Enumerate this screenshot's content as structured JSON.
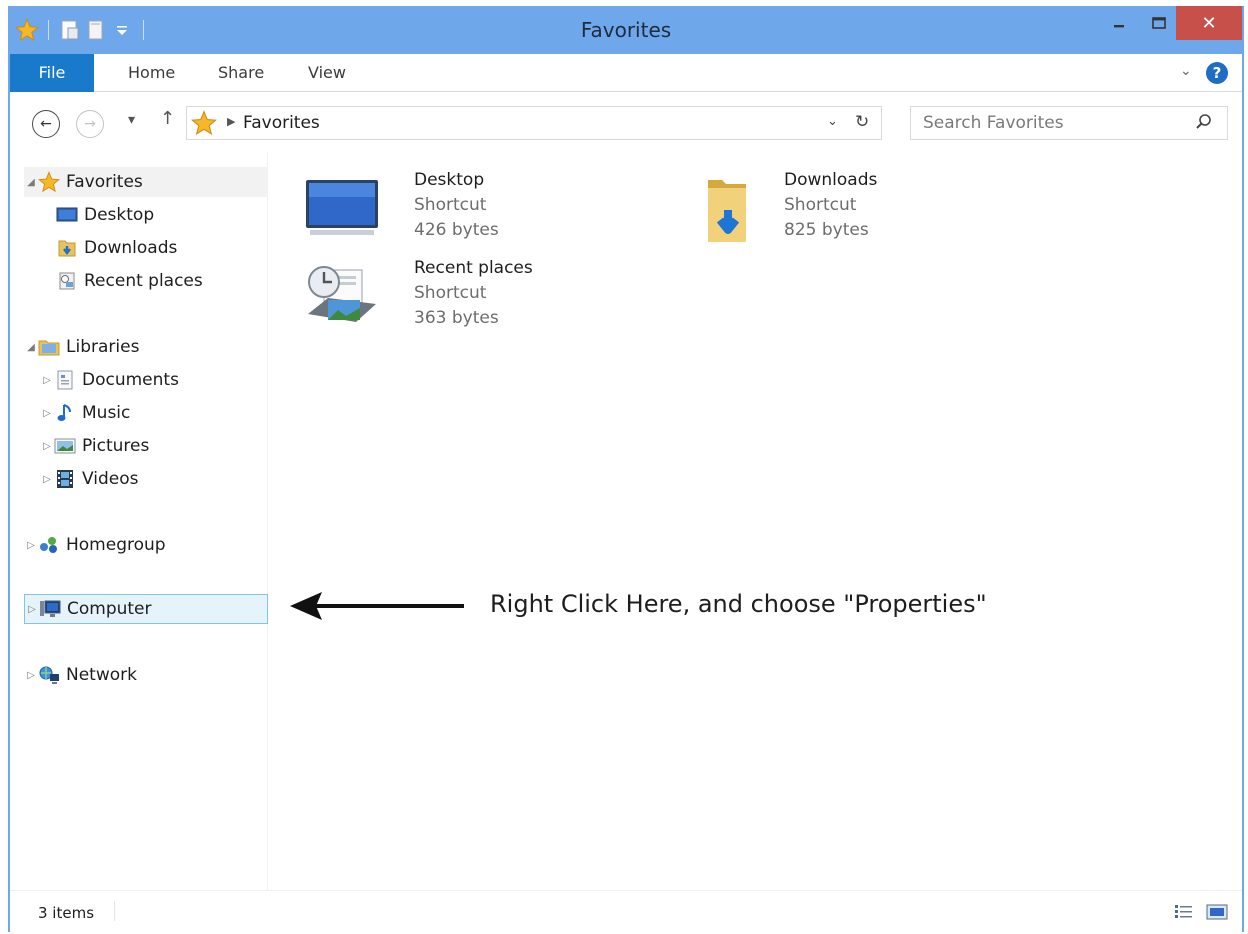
{
  "window": {
    "title": "Favorites",
    "close_glyph": "✕"
  },
  "ribbon": {
    "tabs": [
      "File",
      "Home",
      "Share",
      "View"
    ]
  },
  "address": {
    "breadcrumb": "Favorites",
    "search_placeholder": "Search Favorites"
  },
  "nav": {
    "favorites": {
      "label": "Favorites",
      "items": [
        "Desktop",
        "Downloads",
        "Recent places"
      ]
    },
    "libraries": {
      "label": "Libraries",
      "items": [
        "Documents",
        "Music",
        "Pictures",
        "Videos"
      ]
    },
    "homegroup": "Homegroup",
    "computer": "Computer",
    "network": "Network"
  },
  "files": [
    {
      "name": "Desktop",
      "type": "Shortcut",
      "size": "426 bytes",
      "icon": "desktop-icon"
    },
    {
      "name": "Downloads",
      "type": "Shortcut",
      "size": "825 bytes",
      "icon": "downloads-folder-icon"
    },
    {
      "name": "Recent places",
      "type": "Shortcut",
      "size": "363 bytes",
      "icon": "recent-places-icon"
    }
  ],
  "annotation": {
    "text": "Right Click Here, and choose \"Properties\""
  },
  "status": {
    "item_count": "3 items"
  },
  "colors": {
    "title_bar": "#6ea8ea",
    "file_tab": "#1979ca",
    "close_button": "#c7504b",
    "selection_border": "#84c3e8",
    "selection_fill": "#e5f3fb"
  }
}
